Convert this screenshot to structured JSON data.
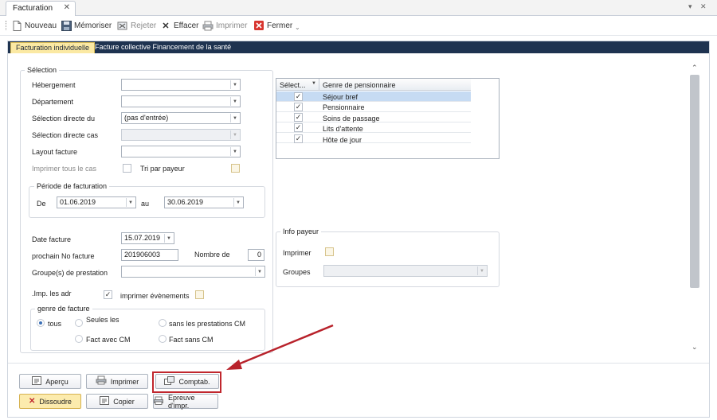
{
  "tab": {
    "title": "Facturation",
    "close": "✕"
  },
  "window_controls": {
    "dropdown": "▾",
    "close": "✕"
  },
  "toolbar": {
    "new": "Nouveau",
    "save": "Mémoriser",
    "reject": "Rejeter",
    "delete": "Effacer",
    "print": "Imprimer",
    "close": "Fermer"
  },
  "form_tabs": [
    "Facturation individuelle",
    "Facture collective Financement de la santé"
  ],
  "selection": {
    "title": "Sélection",
    "hebergement": "Hébergement",
    "departement": "Département",
    "selection_directe_du": "Sélection directe du",
    "selection_directe_du_value": "(pas d'entrée)",
    "selection_directe_cas": "Sélection directe cas",
    "layout_facture": "Layout facture",
    "imprimer_tous": "Imprimer tous le cas",
    "tri_par_payeur": "Tri par payeur"
  },
  "periode": {
    "title": "Période de facturation",
    "de": "De",
    "de_value": "01.06.2019",
    "au": "au",
    "au_value": "30.06.2019"
  },
  "facture": {
    "date_label": "Date facture",
    "date_value": "15.07.2019",
    "no_label": "prochain No facture",
    "no_value": "201906003",
    "nombre_label": "Nombre de",
    "nombre_value": "0",
    "groupes_label": "Groupe(s) de prestation",
    "imp_adr_label": ".Imp. les adr",
    "imprimer_evenements": "imprimer évènements"
  },
  "genre_facture": {
    "title": "genre de facture",
    "tous": "tous",
    "seules": "Seules les prestations CM",
    "sans": "sans les prestations CM",
    "avec_cm": "Fact avec CM",
    "sans_cm": "Fact sans CM"
  },
  "grid": {
    "headers": [
      "Sélect...",
      "Genre de pensionnaire"
    ],
    "rows": [
      {
        "checked": true,
        "label": "Séjour bref"
      },
      {
        "checked": true,
        "label": "Pensionnaire"
      },
      {
        "checked": true,
        "label": "Soins de passage"
      },
      {
        "checked": true,
        "label": "Lits d'attente"
      },
      {
        "checked": true,
        "label": "Hôte de jour"
      }
    ]
  },
  "info_payeur": {
    "title": "Info payeur",
    "imprimer": "Imprimer",
    "groupes": "Groupes"
  },
  "buttons": {
    "apercu": "Aperçu",
    "imprimer": "Imprimer",
    "comptab": "Comptab.",
    "dissoudre": "Dissoudre",
    "copier": "Copier",
    "epreuve": "Epreuve d'impr."
  },
  "colors": {
    "tabbar": "#1e3350",
    "active_tab": "#fbe9a3",
    "annotation": "#c0262d",
    "selected_row": "#c6dbf3"
  }
}
